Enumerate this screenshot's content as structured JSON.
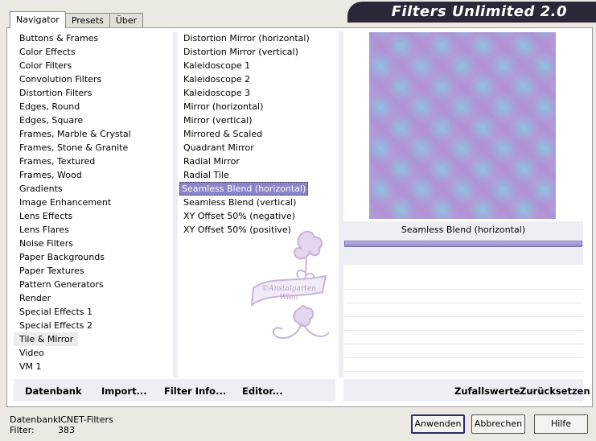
{
  "app": {
    "title": "Filters Unlimited 2.0"
  },
  "tabs": [
    {
      "label": "Navigator",
      "active": true
    },
    {
      "label": "Presets",
      "active": false
    },
    {
      "label": "Über",
      "active": false
    }
  ],
  "categories": [
    "Buttons & Frames",
    "Color Effects",
    "Color Filters",
    "Convolution Filters",
    "Distortion Filters",
    "Edges, Round",
    "Edges, Square",
    "Frames, Marble & Crystal",
    "Frames, Stone & Granite",
    "Frames, Textured",
    "Frames, Wood",
    "Gradients",
    "Image Enhancement",
    "Lens Effects",
    "Lens Flares",
    "Noise Filters",
    "Paper Backgrounds",
    "Paper Textures",
    "Pattern Generators",
    "Render",
    "Special Effects 1",
    "Special Effects 2",
    "Tile & Mirror",
    "Video",
    "VM 1"
  ],
  "selected_category": "Tile & Mirror",
  "filters": [
    "Distortion Mirror (horizontal)",
    "Distortion Mirror (vertical)",
    "Kaleidoscope 1",
    "Kaleidoscope 2",
    "Kaleidoscope 3",
    "Mirror (horizontal)",
    "Mirror (vertical)",
    "Mirrored & Scaled",
    "Quadrant Mirror",
    "Radial Mirror",
    "Radial Tile",
    "Seamless Blend (horizontal)",
    "Seamless Blend (vertical)",
    "XY Offset 50% (negative)",
    "XY Offset 50% (positive)"
  ],
  "selected_filter": "Seamless Blend (horizontal)",
  "preview": {
    "filter_name": "Seamless Blend (horizontal)",
    "colors": [
      "#8ec4e2",
      "#b39ad8"
    ]
  },
  "watermark": {
    "line1": "©Anstalgarten",
    "line2": "Wien"
  },
  "bottom_links_left": {
    "datenbank": "Datenbank",
    "import": "Import...",
    "filter_info": "Filter Info...",
    "editor": "Editor..."
  },
  "bottom_links_right": {
    "zufallswerte": "Zufallswerte",
    "zuruecksetzen": "Zurücksetzen"
  },
  "status": {
    "datenbank_label": "Datenbank:",
    "datenbank_value": "ICNET-Filters",
    "filter_label": "Filter:",
    "filter_value": "383"
  },
  "buttons": {
    "apply": "Anwenden",
    "cancel": "Abbrechen",
    "help": "Hilfe"
  }
}
